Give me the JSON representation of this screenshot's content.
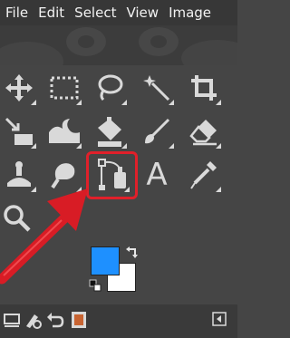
{
  "menubar": {
    "items": [
      "File",
      "Edit",
      "Select",
      "View",
      "Image"
    ]
  },
  "toolbox": {
    "tools": [
      {
        "name": "move-tool",
        "icon": "move-icon"
      },
      {
        "name": "rectangle-select-tool",
        "icon": "rectangle-select-icon"
      },
      {
        "name": "free-select-tool",
        "icon": "lasso-icon"
      },
      {
        "name": "fuzzy-select-tool",
        "icon": "magic-wand-icon"
      },
      {
        "name": "crop-tool",
        "icon": "crop-icon"
      },
      {
        "name": "unified-transform-tool",
        "icon": "transform-icon"
      },
      {
        "name": "warp-transform-tool",
        "icon": "warp-icon"
      },
      {
        "name": "bucket-fill-tool",
        "icon": "bucket-fill-icon"
      },
      {
        "name": "paintbrush-tool",
        "icon": "paintbrush-icon"
      },
      {
        "name": "eraser-tool",
        "icon": "eraser-icon"
      },
      {
        "name": "clone-tool",
        "icon": "clone-stamp-icon"
      },
      {
        "name": "smudge-tool",
        "icon": "smudge-icon"
      },
      {
        "name": "paths-tool",
        "icon": "paths-icon"
      },
      {
        "name": "text-tool",
        "icon": "text-icon"
      },
      {
        "name": "color-picker-tool",
        "icon": "eyedropper-icon"
      },
      {
        "name": "zoom-tool",
        "icon": "magnifier-icon"
      }
    ],
    "highlighted_tool": "paths-tool",
    "text_tool_glyph": "A"
  },
  "colors": {
    "foreground": "#1e90ff",
    "background": "#ffffff",
    "annotation": "#e0202a"
  },
  "bottombar": {
    "buttons": [
      "device-status-icon",
      "tool-options-icon",
      "undo-history-icon",
      "images-icon"
    ],
    "menu_button": "panel-menu-icon"
  }
}
